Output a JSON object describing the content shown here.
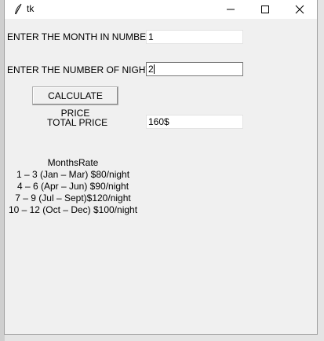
{
  "window": {
    "title": "tk",
    "controls": {
      "minimize": "minimize",
      "maximize": "maximize",
      "close": "close"
    }
  },
  "form": {
    "month_label": "ENTER THE MONTH IN NUMBER",
    "month_value": "1",
    "nights_label": "ENTER THE NUMBER OF NIGHTS",
    "nights_value": "2",
    "calculate_label": "CALCULATE PRICE",
    "total_label": "TOTAL PRICE",
    "total_value": "160$"
  },
  "rates": {
    "heading": "MonthsRate",
    "lines": [
      "1 – 3 (Jan – Mar) $80/night",
      "4 – 6 (Apr – Jun) $90/night",
      "7 – 9 (Jul – Sept)$120/night",
      "10 – 12 (Oct – Dec) $100/night"
    ]
  }
}
